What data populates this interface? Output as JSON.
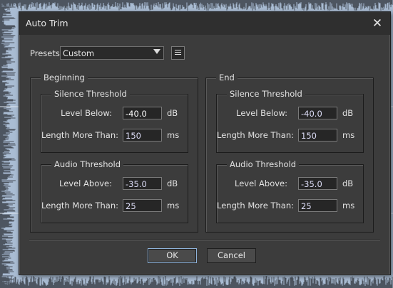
{
  "dialog": {
    "title": "Auto Trim",
    "close_icon": "close-icon"
  },
  "presets": {
    "label": "Presets:",
    "value": "Custom",
    "menu_icon": "list-icon"
  },
  "beginning": {
    "title": "Beginning",
    "silence": {
      "title": "Silence Threshold",
      "level_label": "Level Below:",
      "level_value": "-40.0",
      "level_unit": "dB",
      "length_label": "Length More Than:",
      "length_value": "150",
      "length_unit": "ms"
    },
    "audio": {
      "title": "Audio Threshold",
      "level_label": "Level Above:",
      "level_value": "-35.0",
      "level_unit": "dB",
      "length_label": "Length More Than:",
      "length_value": "25",
      "length_unit": "ms"
    }
  },
  "end": {
    "title": "End",
    "silence": {
      "title": "Silence Threshold",
      "level_label": "Level Below:",
      "level_value": "-40.0",
      "level_unit": "dB",
      "length_label": "Length More Than:",
      "length_value": "150",
      "length_unit": "ms"
    },
    "audio": {
      "title": "Audio Threshold",
      "level_label": "Level Above:",
      "level_value": "-35.0",
      "level_unit": "dB",
      "length_label": "Length More Than:",
      "length_value": "25",
      "length_unit": "ms"
    }
  },
  "buttons": {
    "ok": "OK",
    "cancel": "Cancel"
  },
  "colors": {
    "dialog_bg": "#3c3c3c",
    "titlebar_bg": "#2f2f2f",
    "backdrop": "#a9bcd3",
    "waveform": "#4d5560",
    "accent": "#8fb3da"
  }
}
